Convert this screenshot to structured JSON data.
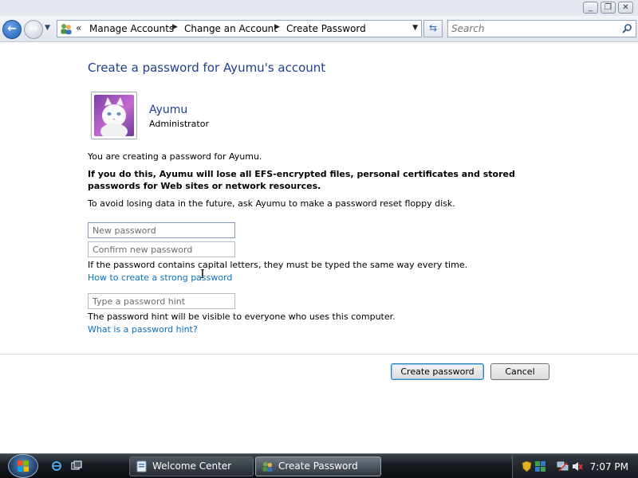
{
  "window": {
    "minimize_label": "_",
    "maximize_label": "❐",
    "close_label": "✕"
  },
  "nav": {
    "back_glyph": "←",
    "forward_glyph": "→",
    "history_glyph": "▼",
    "address_prefix": "«",
    "breadcrumbs": [
      "Manage Accounts",
      "Change an Account",
      "Create Password"
    ],
    "crumb_separator": "▶",
    "dropdown_glyph": "▼",
    "refresh_glyph": "⇆",
    "search_placeholder": "Search"
  },
  "page": {
    "title": "Create a password for Ayumu's account",
    "user_name": "Ayumu",
    "user_role": "Administrator",
    "intro": "You are creating a password for Ayumu.",
    "warning": "If you do this, Ayumu will lose all EFS-encrypted files, personal certificates and stored passwords for Web sites or network resources.",
    "advice": "To avoid losing data in the future, ask Ayumu to make a password reset floppy disk.",
    "new_password_placeholder": "New password",
    "confirm_password_placeholder": "Confirm new password",
    "caps_note": "If the password contains capital letters, they must be typed the same way every time.",
    "strong_password_link": "How to create a strong password",
    "hint_placeholder": "Type a password hint",
    "hint_note": "The password hint will be visible to everyone who uses this computer.",
    "hint_link": "What is a password hint?",
    "create_button": "Create password",
    "cancel_button": "Cancel"
  },
  "taskbar": {
    "tasks": [
      {
        "label": "Welcome Center",
        "icon": "welcome-center-icon"
      },
      {
        "label": "Create Password",
        "icon": "user-accounts-icon"
      }
    ],
    "clock": "7:07 PM"
  },
  "colors": {
    "title_blue": "#1e3f8b",
    "link_blue": "#0a6fbd"
  }
}
